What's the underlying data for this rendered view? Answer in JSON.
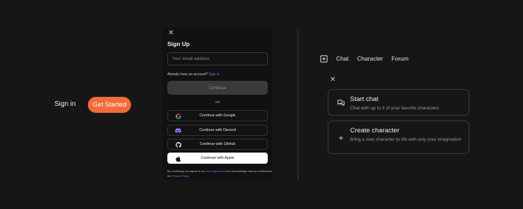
{
  "landing": {
    "signin_label": "Sign in",
    "get_started_label": "Get Started"
  },
  "signup": {
    "title": "Sign Up",
    "email_placeholder": "Your email address",
    "account_prompt": "Already have an account?",
    "signin_link": "Sign in",
    "continue_label": "Continue",
    "or_label": "OR",
    "providers": {
      "google": "Continue with Google",
      "discord": "Continue with Discord",
      "github": "Continue with GitHub",
      "apple": "Continue with Apple"
    },
    "terms": {
      "prefix": "By continuing, you agree to our",
      "user_agreement": "User Agreement",
      "middle": "and acknowledge that you understand the",
      "privacy_policy": "Privacy Policy",
      "suffix": "."
    }
  },
  "nav": {
    "items": [
      "Chat",
      "Character",
      "Forum"
    ],
    "icon": "plus-square-icon"
  },
  "menu": {
    "start_chat": {
      "title": "Start chat",
      "description": "Chat with up to 3 of your favorite characters",
      "icon": "chat-bubbles-icon"
    },
    "create_character": {
      "title": "Create character",
      "description": "Bring a new character to life with only your imagination",
      "icon": "plus-icon"
    }
  },
  "colors": {
    "accent": "#f26b3a",
    "link": "#6f7df0",
    "background": "#161616"
  }
}
